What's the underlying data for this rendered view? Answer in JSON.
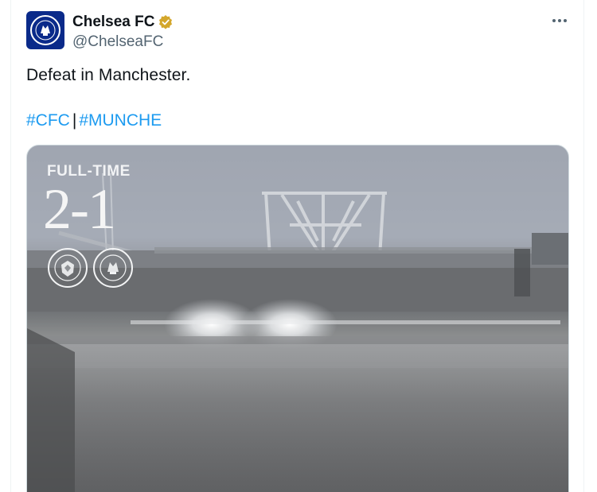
{
  "account": {
    "display_name": "Chelsea FC",
    "handle": "@ChelseaFC",
    "verified": true,
    "avatar_icon": "chelsea-crest-icon",
    "verified_color": "#d4a72c"
  },
  "tweet": {
    "text": "Defeat in Manchester.",
    "hashtags": [
      "#CFC",
      "#MUNCHE"
    ],
    "separator": "|"
  },
  "media": {
    "label": "FULL-TIME",
    "score": "2-1",
    "home_crest": "manchester-united-crest-icon",
    "away_crest": "chelsea-crest-icon"
  },
  "menu": {
    "icon": "more-options-icon"
  },
  "colors": {
    "link": "#1d9bf0",
    "text": "#0f1419",
    "secondary": "#536471"
  }
}
